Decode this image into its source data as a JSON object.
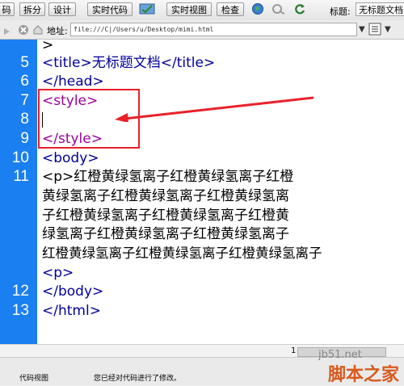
{
  "toolbar": {
    "code_label": "码",
    "split_label": "拆分",
    "design_label": "设计",
    "live_code_label": "实时代码",
    "live_view_label": "实时视图",
    "inspect_label": "检查",
    "title_label": "标题:",
    "title_value": "无标题文档"
  },
  "address": {
    "label": "地址:",
    "url": "file:///C|/Users/u/Desktop/mimi.html"
  },
  "code": {
    "lines": [
      {
        "num": "",
        "text": ">"
      },
      {
        "num": "5",
        "text": "<title>无标题文档</title>"
      },
      {
        "num": "6",
        "text": "</head>"
      },
      {
        "num": "7",
        "text": "<style>"
      },
      {
        "num": "8",
        "text": ""
      },
      {
        "num": "9",
        "text": "</style>"
      },
      {
        "num": "10",
        "text": "<body>"
      },
      {
        "num": "11",
        "text": "<p>红橙黄绿氢离子红橙黄绿氢离子红橙"
      },
      {
        "num": "",
        "text": "黄绿氢离子红橙黄绿氢离子红橙黄绿氢离"
      },
      {
        "num": "",
        "text": "子红橙黄绿氢离子红橙黄绿氢离子红橙黄"
      },
      {
        "num": "",
        "text": "绿氢离子红橙黄绿氢离子红橙黄绿氢离子"
      },
      {
        "num": "",
        "text": "红橙黄绿氢离子红橙黄绿氢离子红橙黄绿氢离子"
      },
      {
        "num": "",
        "text": "<p>"
      },
      {
        "num": "12",
        "text": "</body>"
      },
      {
        "num": "13",
        "text": "</html>"
      }
    ]
  },
  "status": {
    "mode_label": "代码视图",
    "message": "您已经对代码进行了修改。",
    "scroll_number": "1"
  },
  "watermark": {
    "site": "jb51.net",
    "brand": "脚本之家"
  },
  "colors": {
    "gutter": "#1a7ff0",
    "tag": "#000099",
    "style_tag": "#990099",
    "annotation": "#e8212a"
  }
}
